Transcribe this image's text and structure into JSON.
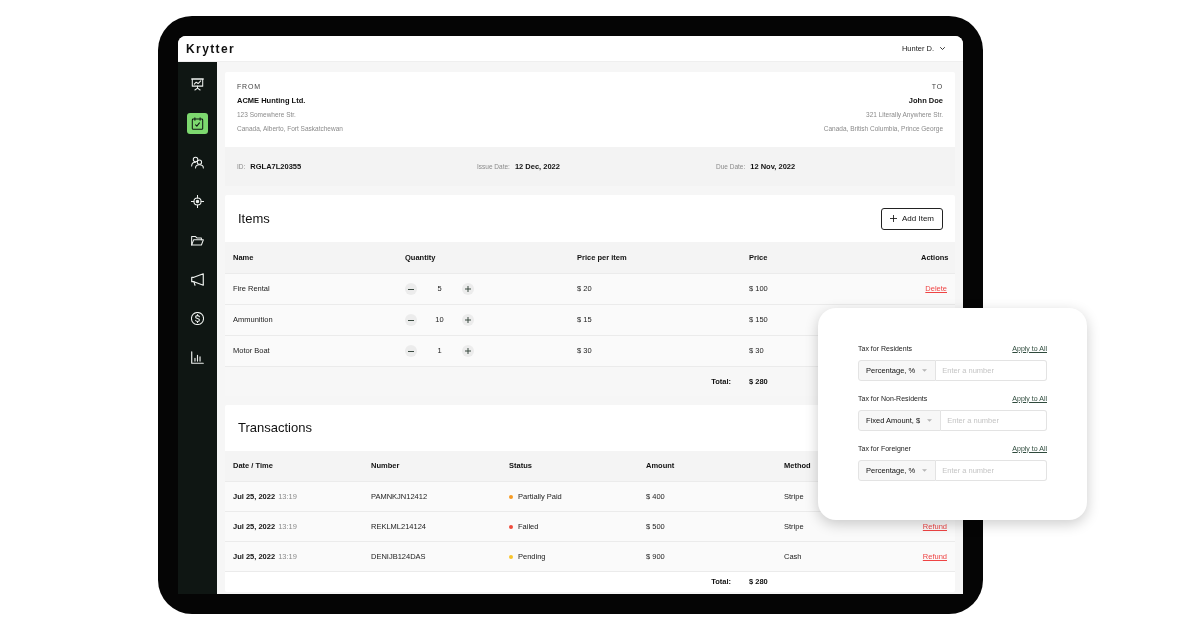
{
  "app": {
    "logo": "Krytter",
    "user": "Hunter D."
  },
  "sidebar": {
    "items": [
      {
        "selected": false
      },
      {
        "selected": true
      },
      {
        "selected": false
      },
      {
        "selected": false
      },
      {
        "selected": false
      },
      {
        "selected": false
      },
      {
        "selected": false
      },
      {
        "selected": false
      }
    ]
  },
  "invoice": {
    "from": {
      "label": "FROM",
      "name": "ACME Hunting Ltd.",
      "address": "123 Somewhere Str.",
      "region": "Canada, Alberto, Fort Saskatchewan"
    },
    "to": {
      "label": "TO",
      "name": "John Doe",
      "address": "321 Literally Anywhere Str.",
      "region": "Canada, British Columbia, Prince George"
    },
    "meta": [
      {
        "label": "ID:",
        "value": "RGLA7L20355"
      },
      {
        "label": "Issue Date:",
        "value": "12 Dec, 2022"
      },
      {
        "label": "Due Date:",
        "value": "12 Nov, 2022"
      }
    ]
  },
  "items": {
    "title": "Items",
    "add_button": "Add Item",
    "columns": [
      "Name",
      "Quantity",
      "Price per item",
      "Price",
      "Actions"
    ],
    "rows": [
      {
        "name": "Fire Rental",
        "quantity": "5",
        "price_per_item": "$ 20",
        "price": "$ 100",
        "action": "Delete"
      },
      {
        "name": "Ammunition",
        "quantity": "10",
        "price_per_item": "$ 15",
        "price": "$ 150"
      },
      {
        "name": "Motor Boat",
        "quantity": "1",
        "price_per_item": "$ 30",
        "price": "$ 30"
      }
    ],
    "total_label": "Total:",
    "total": "$ 280"
  },
  "transactions": {
    "title": "Transactions",
    "columns": [
      "Date / Time",
      "Number",
      "Status",
      "Amount",
      "Method"
    ],
    "rows": [
      {
        "date": "Jul 25, 2022",
        "time": "13:19",
        "number": "PAMNKJN12412",
        "status": "Partially Paid",
        "color": "#f59a23",
        "amount": "$ 400",
        "method": "Stripe"
      },
      {
        "date": "Jul 25, 2022",
        "time": "13:19",
        "number": "REKLML214124",
        "status": "Failed",
        "color": "#ef4b3c",
        "amount": "$ 500",
        "method": "Stripe",
        "action": "Refund"
      },
      {
        "date": "Jul 25, 2022",
        "time": "13:19",
        "number": "DENIJB124DAS",
        "status": "Pending",
        "color": "#f8c42c",
        "amount": "$ 900",
        "method": "Cash",
        "action": "Refund"
      }
    ],
    "total_label": "Total:",
    "total": "$ 280"
  },
  "tax_popup": {
    "groups": [
      {
        "label": "Tax for Residents",
        "link": "Apply to All",
        "unit": "Percentage, %",
        "placeholder": "Enter a number"
      },
      {
        "label": "Tax for Non-Residents",
        "link": "Apply to All",
        "unit": "Fixed Amount, $",
        "placeholder": "Enter a number"
      },
      {
        "label": "Tax for Foreigner",
        "link": "Apply to All",
        "unit": "Percentage, %",
        "placeholder": "Enter a number"
      }
    ]
  }
}
